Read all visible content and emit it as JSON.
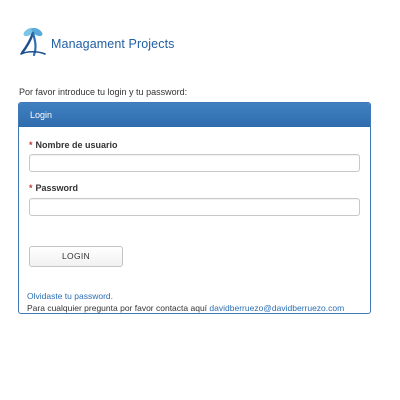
{
  "header": {
    "logo_text": "Managament Projects"
  },
  "intro_text": "Por favor introduce tu login y tu password:",
  "panel": {
    "title": "Login",
    "username_label": "Nombre de usuario",
    "password_label": "Password",
    "required_marker": "*",
    "username_value": "",
    "password_value": "",
    "login_button": "LOGIN",
    "forgot_link": "Olvidaste tu password.",
    "contact_text": "Para cualquier pregunta por favor contacta aquí",
    "contact_email": "davidberruezo@davidberruezo.com"
  },
  "colors": {
    "accent": "#2f6cae",
    "link": "#2a6db3",
    "logo_text": "#1f5fa3"
  }
}
